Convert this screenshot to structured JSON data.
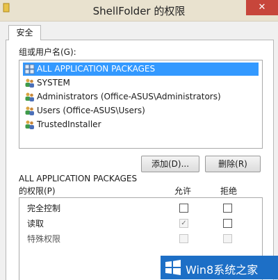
{
  "window": {
    "title": "ShellFolder 的权限",
    "close_label": "✕"
  },
  "tabs": [
    {
      "label": "安全"
    }
  ],
  "group_label": "组或用户名(G):",
  "users": [
    {
      "name": "ALL APPLICATION PACKAGES",
      "icon": "app-packages-icon",
      "selected": true
    },
    {
      "name": "SYSTEM",
      "icon": "users-group-icon"
    },
    {
      "name": "Administrators (Office-ASUS\\Administrators)",
      "icon": "users-group-icon"
    },
    {
      "name": "Users (Office-ASUS\\Users)",
      "icon": "users-group-icon"
    },
    {
      "name": "TrustedInstaller",
      "icon": "users-group-icon"
    }
  ],
  "buttons": {
    "add": "添加(D)...",
    "remove": "删除(R)"
  },
  "permissions": {
    "header_title": "ALL APPLICATION PACKAGES",
    "header_sub": "的权限(P)",
    "allow_label": "允许",
    "deny_label": "拒绝",
    "rows": [
      {
        "label": "完全控制",
        "allow": false,
        "deny": false,
        "disabled": false
      },
      {
        "label": "读取",
        "allow": true,
        "deny": false,
        "disabled": false,
        "allow_disabled": true
      },
      {
        "label": "特殊权限",
        "allow": false,
        "deny": false,
        "disabled": true
      }
    ]
  },
  "watermark": {
    "text": "Win8系统之家"
  },
  "colors": {
    "selection": "#3399ff",
    "close": "#c7463b",
    "watermark": "#1d6fc6"
  }
}
